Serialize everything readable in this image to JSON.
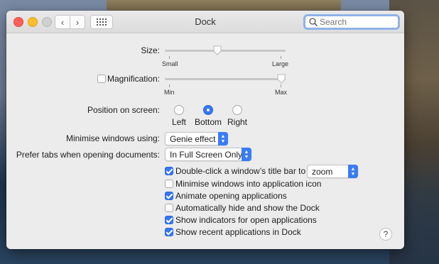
{
  "window": {
    "title": "Dock",
    "search_placeholder": "Search"
  },
  "size": {
    "label": "Size:",
    "min_label": "Small",
    "max_label": "Large",
    "value": 0.43
  },
  "magnification": {
    "label": "Magnification:",
    "checked": false,
    "min_label": "Min",
    "max_label": "Max",
    "value": 1.0
  },
  "position": {
    "label": "Position on screen:",
    "options": [
      "Left",
      "Bottom",
      "Right"
    ],
    "selected": "Bottom"
  },
  "minimise": {
    "label": "Minimise windows using:",
    "value": "Genie effect"
  },
  "tabs": {
    "label": "Prefer tabs when opening documents:",
    "value": "In Full Screen Only"
  },
  "options": {
    "double_click": {
      "label": "Double-click a window’s title bar to",
      "checked": true,
      "popup_value": "zoom"
    },
    "minimise_into_icon": {
      "label": "Minimise windows into application icon",
      "checked": false
    },
    "animate": {
      "label": "Animate opening applications",
      "checked": true
    },
    "autohide": {
      "label": "Automatically hide and show the Dock",
      "checked": false
    },
    "indicators": {
      "label": "Show indicators for open applications",
      "checked": true
    },
    "recent": {
      "label": "Show recent applications in Dock",
      "checked": true
    }
  },
  "help": {
    "label": "?"
  },
  "icons": [
    "close-button",
    "minimize-button",
    "zoom-button",
    "chevron-left-icon",
    "chevron-right-icon",
    "grid-icon",
    "magnifier-icon",
    "help-icon"
  ],
  "colors": {
    "accent": "#3477f6",
    "window_bg": "#ececec"
  }
}
